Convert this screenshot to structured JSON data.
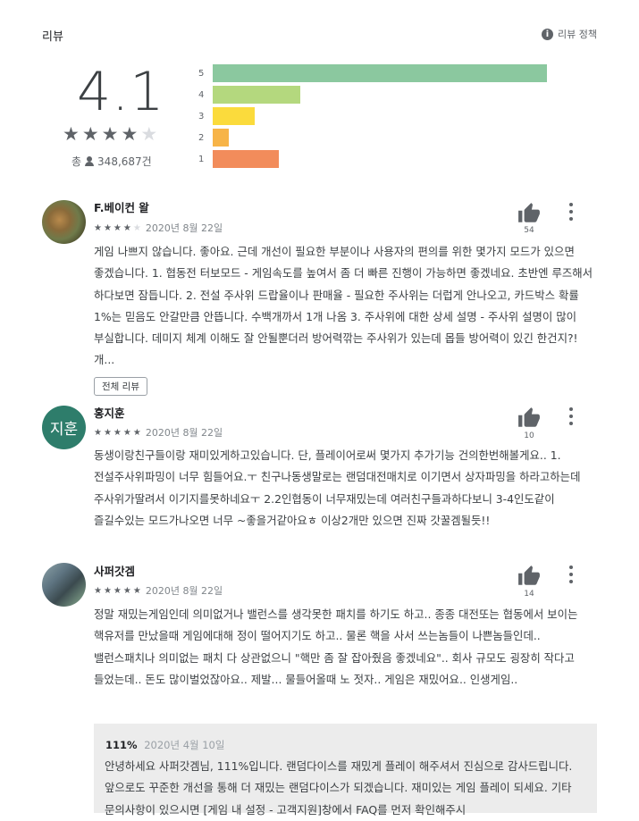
{
  "header": {
    "title": "리뷰",
    "policy_label": "리뷰 정책",
    "policy_icon": "info-icon"
  },
  "summary": {
    "rating": "4.1",
    "stars": 4,
    "total_prefix": "총",
    "total_count": "348,687건",
    "bars": [
      {
        "label": "5",
        "fraction": 0.96,
        "color": "#8bc89f"
      },
      {
        "label": "4",
        "fraction": 0.25,
        "color": "#b4d87e"
      },
      {
        "label": "3",
        "fraction": 0.12,
        "color": "#fbdb3c"
      },
      {
        "label": "2",
        "fraction": 0.045,
        "color": "#f7b448"
      },
      {
        "label": "1",
        "fraction": 0.19,
        "color": "#f28c5b"
      }
    ]
  },
  "reviews": [
    {
      "author": "F.베이컨 왈",
      "stars": 4,
      "date": "2020년 8월 22일",
      "likes": "54",
      "text": "게임 나쁘지 않습니다. 좋아요. 근데 개선이 필요한 부분이나 사용자의 편의를 위한 몇가지 모드가 있으면 좋겠습니다. 1. 협동전 터보모드 - 게임속도를 높여서 좀 더 빠른 진행이 가능하면 좋겠네요. 초반엔 루즈해서 하다보면 잠듭니다. 2. 전설 주사위 드랍율이나 판매율 - 필요한 주사위는 더럽게 안나오고, 카드박스 확률 1%는 믿음도 안갈만큼 안뜹니다. 수백개까서 1개 나옴 3. 주사위에 대한 상세 설명 - 주사위 설명이 많이 부실합니다. 데미지 체계 이해도 잘 안될뿐더러 방어력깎는 주사위가 있는데 몹들 방어력이 있긴 한건지?! 개...",
      "full_review_label": "전체 리뷰"
    },
    {
      "author": "홍지훈",
      "avatar_initials": "지훈",
      "stars": 5,
      "date": "2020년 8월 22일",
      "likes": "10",
      "text": "동생이랑친구들이랑 재미있게하고있습니다. 단, 플레이어로써 몇가지 추가기능 건의한번해볼게요.. 1.전설주사위파밍이 너무 힘들어요.ㅜ 친구나동생말로는 랜덤대전매치로 이기면서 상자파밍을 하라고하는데 주사위가딸려서 이기지를못하네요ㅜ 2.2인협동이 너무재밌는데 여러친구들과하다보니 3-4인도같이 즐길수있는 모드가나오면 너무 ~좋을거같아요ㅎ 이상2개만 있으면 진짜 갓꿀겜될듯!!"
    },
    {
      "author": "사퍼갓겜",
      "stars": 5,
      "date": "2020년 8월 22일",
      "likes": "14",
      "text": "정말 재밌는게임인데 의미없거나 밸런스를 생각못한 패치를 하기도 하고.. 종종 대전또는 협동에서 보이는 핵유저를 만났을때 게임에대해 정이 떨어지기도 하고.. 물론 핵을 사서 쓰는놈들이 나쁜놈들인데.. 밸런스패치나 의미없는 패치 다 상관없으니 \"핵만 좀 잘 잡아줬음 좋겠네요\".. 회사 규모도 굉장히 작다고 들었는데.. 돈도 많이벌었잖아요.. 제발... 물들어올때 노 젓자.. 게임은 재밌어요.. 인생게임..",
      "reply": {
        "author": "111%",
        "date": "2020년 4월 10일",
        "text": "안녕하세요 사퍼갓겜님, 111%입니다. 랜덤다이스를 재밌게 플레이 해주셔서 진심으로 감사드립니다. 앞으로도 꾸준한 개선을 통해 더 재밌는 랜덤다이스가 되겠습니다. 재미있는 게임 플레이 되세요. 기타 문의사항이 있으시면 [게임 내 설정 - 고객지원]창에서 FAQ를 먼저 확인해주시"
      }
    }
  ]
}
